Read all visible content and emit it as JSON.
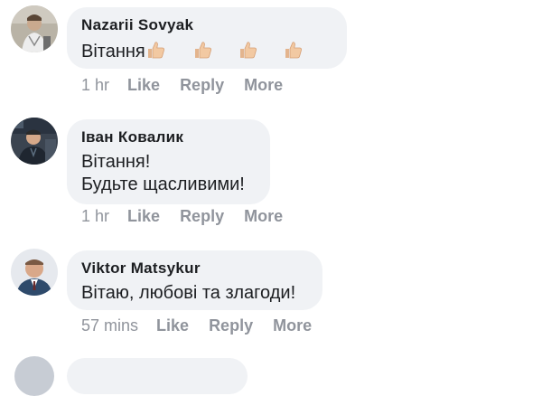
{
  "comments": [
    {
      "author": "Nazarii Sovyak",
      "text_lines": [
        "Вітання"
      ],
      "time": "1 hr",
      "actions": {
        "like": "Like",
        "reply": "Reply",
        "more": "More"
      },
      "emoji": [
        "thumbs-up",
        "thumbs-up",
        "thumbs-up",
        "thumbs-up"
      ]
    },
    {
      "author": "Іван Ковалик",
      "text_lines": [
        "Вітання!",
        "Будьте щасливими!"
      ],
      "time": "1 hr",
      "actions": {
        "like": "Like",
        "reply": "Reply",
        "more": "More"
      }
    },
    {
      "author": "Viktor Matsykur",
      "text_lines": [
        "Вітаю, любові та злагоди!"
      ],
      "time": "57 mins",
      "actions": {
        "like": "Like",
        "reply": "Reply",
        "more": "More"
      }
    }
  ],
  "colors": {
    "bubble": "#f0f2f5",
    "name": "#1c1e21",
    "meta": "#90949c"
  }
}
